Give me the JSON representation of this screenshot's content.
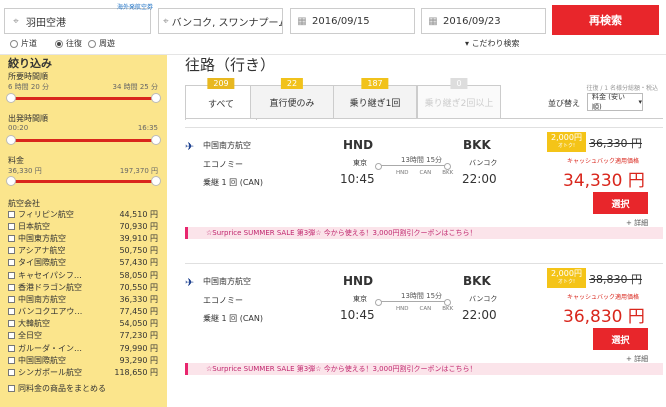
{
  "search": {
    "origin": "羽田空港",
    "overseas_link": "海外発航空券",
    "destination": "バンコク, スワンナプーム国際",
    "depart_date": "2016/09/15",
    "return_date": "2016/09/23",
    "search_button": "再検索",
    "trip_types": [
      "片道",
      "往復",
      "周遊"
    ],
    "selected_trip": "往復",
    "advanced": "こだわり検索"
  },
  "sidebar": {
    "title": "絞り込み",
    "duration": {
      "label": "所要時間順",
      "min": "6 時間 20 分",
      "max": "34 時間 25 分"
    },
    "departure": {
      "label": "出発時間順",
      "min": "00:20",
      "max": "16:35"
    },
    "price": {
      "label": "料金",
      "min": "36,330 円",
      "max": "197,370 円"
    },
    "airlines_label": "航空会社",
    "airlines": [
      {
        "name": "フィリピン航空",
        "price": "44,510 円"
      },
      {
        "name": "日本航空",
        "price": "70,930 円"
      },
      {
        "name": "中国東方航空",
        "price": "39,910 円"
      },
      {
        "name": "アシアナ航空",
        "price": "50,750 円"
      },
      {
        "name": "タイ国際航空",
        "price": "57,430 円"
      },
      {
        "name": "キャセイパシフ…",
        "price": "58,050 円"
      },
      {
        "name": "香港ドラゴン航空",
        "price": "70,550 円"
      },
      {
        "name": "中国南方航空",
        "price": "36,330 円"
      },
      {
        "name": "バンコクエアウ…",
        "price": "77,450 円"
      },
      {
        "name": "大韓航空",
        "price": "54,050 円"
      },
      {
        "name": "全日空",
        "price": "77,230 円"
      },
      {
        "name": "ガルーダ・イン…",
        "price": "79,990 円"
      },
      {
        "name": "中国国際航空",
        "price": "93,290 円"
      },
      {
        "name": "シンガポール航空",
        "price": "118,650 円"
      }
    ],
    "group_label": "同料金の商品をまとめる"
  },
  "main": {
    "title": "往路（行き）",
    "tabs": [
      {
        "label": "すべて",
        "count": "209",
        "color": "#e8b820"
      },
      {
        "label": "直行便のみ",
        "count": "22",
        "color": "#f1c21b"
      },
      {
        "label": "乗り継ぎ1回",
        "count": "187",
        "color": "#f1c21b"
      },
      {
        "label": "乗り継ぎ2回以上",
        "count": "0",
        "color": "#dddddd"
      }
    ],
    "sort_info": "往復 / 1 名様分総額・税込",
    "sort_label": "並び替え",
    "sort_value": "料金 (安い順)"
  },
  "results": [
    {
      "airline": "中国南方航空",
      "cabin": "エコノミー",
      "transfer": "乗継 1 回 (CAN)",
      "dep_code": "HND",
      "dep_city": "東京",
      "dep_time": "10:45",
      "arr_code": "BKK",
      "arr_city": "バンコク",
      "arr_time": "22:00",
      "duration": "13時間 15分",
      "stops": [
        "HND",
        "CAN",
        "BKK"
      ],
      "discount": "2,000円",
      "discount_sub": "オトク!",
      "original_price": "36,330 円",
      "cashback_label": "キャッシュバック適用価格",
      "price": "34,330 円",
      "select": "選択",
      "detail": "+ 詳細",
      "promo": "☆Surprice SUMMER SALE 第3弾☆ 今から使える！3,000円割引クーポンはこちら！"
    },
    {
      "airline": "中国南方航空",
      "cabin": "エコノミー",
      "transfer": "乗継 1 回 (CAN)",
      "dep_code": "HND",
      "dep_city": "東京",
      "dep_time": "10:45",
      "arr_code": "BKK",
      "arr_city": "バンコク",
      "arr_time": "22:00",
      "duration": "13時間 15分",
      "stops": [
        "HND",
        "CAN",
        "BKK"
      ],
      "discount": "2,000円",
      "discount_sub": "オトク!",
      "original_price": "38,830 円",
      "cashback_label": "キャッシュバック適用価格",
      "price": "36,830 円",
      "select": "選択",
      "detail": "+ 詳細",
      "promo": "☆Surprice SUMMER SALE 第3弾☆ 今から使える！3,000円割引クーポンはこちら！"
    }
  ]
}
